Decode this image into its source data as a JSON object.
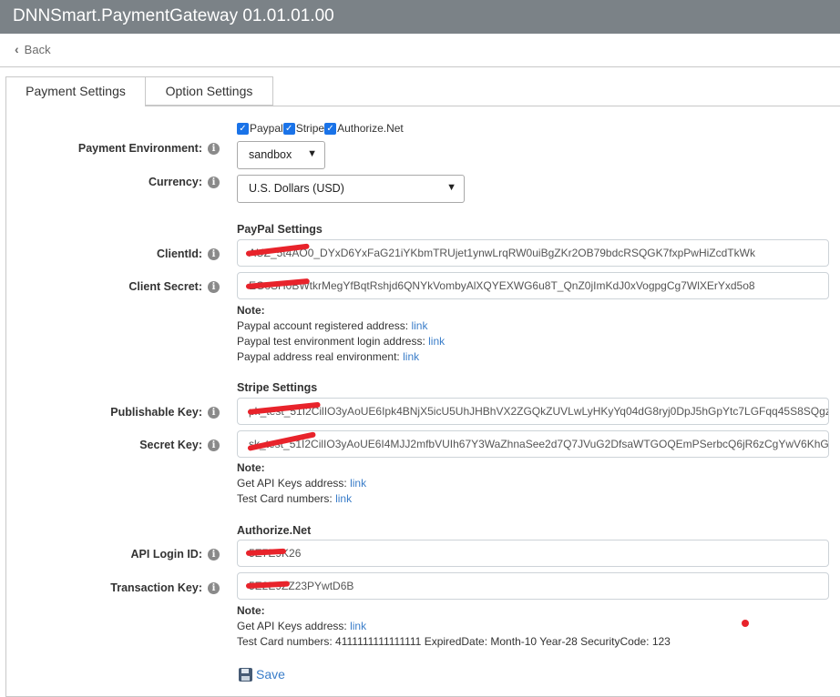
{
  "title": "DNNSmart.PaymentGateway 01.01.01.00",
  "back_label": "Back",
  "tabs": [
    "Payment Settings",
    "Option Settings"
  ],
  "gateways": [
    "Paypal",
    "Stripe",
    "Authorize.Net"
  ],
  "payment_environment": {
    "label": "Payment Environment:",
    "value": "sandbox"
  },
  "currency": {
    "label": "Currency:",
    "value": "U.S. Dollars (USD)"
  },
  "paypal": {
    "heading": "PayPal Settings",
    "client_id_label": "ClientId:",
    "client_id_value": "AUZ_5t4AO0_DYxD6YxFaG21iYKbmTRUjet1ynwLrqRW0uiBgZKr2OB79bdcRSQGK7fxpPwHiZcdTkWk",
    "client_secret_label": "Client Secret:",
    "client_secret_value": "EGoSH0BWtkrMegYfBqtRshjd6QNYkVombyAlXQYEXWG6u8T_QnZ0jImKdJ0xVogpgCg7WlXErYxd5o8",
    "note_title": "Note:",
    "notes": [
      {
        "text": "Paypal account registered address:",
        "link": "link"
      },
      {
        "text": "Paypal test environment login address:",
        "link": "link"
      },
      {
        "text": "Paypal address real environment:",
        "link": "link"
      }
    ]
  },
  "stripe": {
    "heading": "Stripe Settings",
    "publishable_label": "Publishable Key:",
    "publishable_value": "pk_test_51I2CilIO3yAoUE6Ipk4BNjX5icU5UhJHBhVX2ZGQkZUVLwLyHKyYq04dG8ryj0DpJ5hGpYtc7LGFqq45S8SQgz",
    "secret_label": "Secret Key:",
    "secret_value": "sk_test_51I2CilIO3yAoUE6I4MJJ2mfbVUIh67Y3WaZhnaSee2d7Q7JVuG2DfsaWTGOQEmPSerbcQ6jR6zCgYwV6KhG",
    "note_title": "Note:",
    "notes": [
      {
        "text": "Get API Keys address:",
        "link": "link"
      },
      {
        "text": "Test Card numbers:",
        "link": "link"
      }
    ]
  },
  "authorize": {
    "heading": "Authorize.Net",
    "login_label": "API Login ID:",
    "login_value": "5E7E9K26",
    "tx_label": "Transaction Key:",
    "tx_value": "5E2E9ZZ23PYwtD6B",
    "note_title": "Note:",
    "api_keys_text": "Get API Keys address:",
    "api_keys_link": "link",
    "test_card_text": "Test Card numbers: 4111111111111111 ExpiredDate: Month-10 Year-28 SecurityCode: 123"
  },
  "save_label": "Save",
  "colors": {
    "titlebar": "#7b8287",
    "link": "#3a7dc9",
    "checkbox": "#1a73e8",
    "redaction": "#e8232b"
  },
  "icons": {
    "back": "chevron-left-icon",
    "info": "info-icon",
    "save": "floppy-disk-icon"
  }
}
